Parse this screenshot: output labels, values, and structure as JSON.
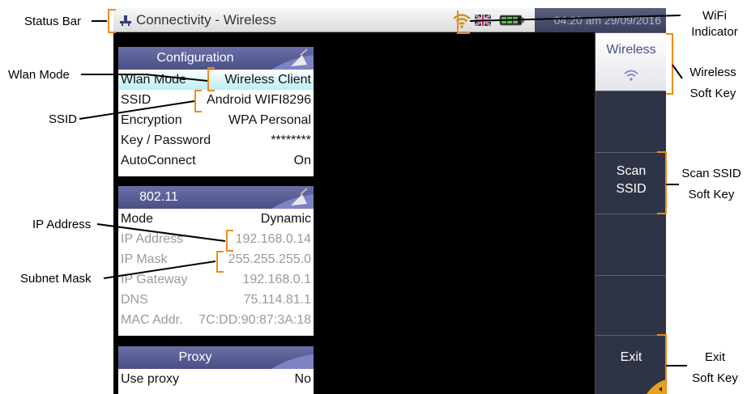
{
  "status_bar": {
    "title": "Connectivity - Wireless",
    "clock": "04:20 am 29/09/2016",
    "icons": [
      "connectivity-icon",
      "wifi-icon",
      "flag-icon",
      "battery-icon"
    ]
  },
  "config_panel": {
    "header": "Configuration",
    "rows": [
      {
        "label": "Wlan Mode",
        "value": "Wireless Client"
      },
      {
        "label": "SSID",
        "value": "Android WIFI8296"
      },
      {
        "label": "Encryption",
        "value": "WPA Personal"
      },
      {
        "label": "Key / Password",
        "value": "********"
      },
      {
        "label": "AutoConnect",
        "value": "On"
      }
    ]
  },
  "wifi_panel": {
    "header": "802.11",
    "rows": [
      {
        "label": "Mode",
        "value": "Dynamic"
      },
      {
        "label": "IP Address",
        "value": "192.168.0.14"
      },
      {
        "label": "IP Mask",
        "value": "255.255.255.0"
      },
      {
        "label": "IP Gateway",
        "value": "192.168.0.1"
      },
      {
        "label": "DNS",
        "value": "75.114.81.1"
      },
      {
        "label": "MAC Addr.",
        "value": "7C:DD:90:87:3A:18"
      }
    ]
  },
  "proxy_panel": {
    "header": "Proxy",
    "rows": [
      {
        "label": "Use proxy",
        "value": "No"
      }
    ]
  },
  "softkeys": {
    "wireless": "Wireless",
    "scan_line1": "Scan",
    "scan_line2": "SSID",
    "exit": "Exit"
  },
  "annotations": {
    "status_bar": "Status  Bar",
    "wlan_mode": "Wlan Mode",
    "ssid": "SSID",
    "ip_address": "IP Address",
    "subnet_mask": "Subnet Mask",
    "wifi_indicator_1": "WiFi",
    "wifi_indicator_2": "Indicator",
    "wireless_key_1": "Wireless",
    "wireless_key_2": "Soft Key",
    "scan_key_1": "Scan SSID",
    "scan_key_2": "Soft Key",
    "exit_key_1": "Exit",
    "exit_key_2": "Soft Key"
  },
  "colors": {
    "panel_header": "#5a5f96",
    "highlight": "#b9eef8",
    "callout": "#f08a1c",
    "softkey": "#2e3445"
  }
}
